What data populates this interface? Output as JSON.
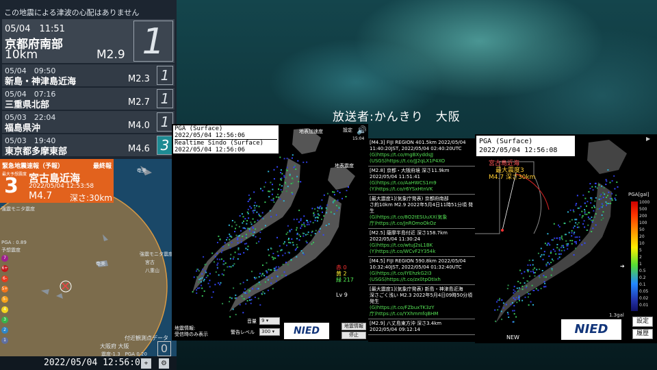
{
  "broadcaster": "放送者:かんきり　大阪",
  "left": {
    "tsunami_notice": "この地震による津波の心配はありません",
    "latest": {
      "time": "05/04　11:51",
      "region": "京都府南部",
      "depth": "10km",
      "magnitude": "M2.9",
      "intensity": "1"
    },
    "history": [
      {
        "time": "05/04　09:50",
        "region": "新島・神津島近海",
        "magnitude": "M2.3",
        "intensity": "1"
      },
      {
        "time": "05/04　07:16",
        "region": "三重県北部",
        "magnitude": "M2.7",
        "intensity": "1"
      },
      {
        "time": "05/03　22:04",
        "region": "福島県沖",
        "magnitude": "M4.0",
        "intensity": "1"
      },
      {
        "time": "05/03　19:40",
        "region": "東京都多摩東部",
        "magnitude": "M4.6",
        "intensity": "3"
      }
    ],
    "eew": {
      "header": "緊急地震速報（予報）",
      "final": "最終報",
      "max_label": "最大予想震度",
      "intensity": "3",
      "region": "宮古島近海",
      "time": "2022/05/04 12:53:58",
      "magnitude": "M4.7",
      "depth": "深さ:30km"
    },
    "map_labels": {
      "amami": "奄美",
      "station_label": "強震モニタ震度",
      "pga_label": "PGA : 0.89",
      "forecast_label": "予想震度",
      "miyako": "宮古",
      "yaeyama": "八重山",
      "nearby": "付近観測点データ",
      "osaka": "大阪府 大阪",
      "intensity_info": "震度-1.3　PGA 0.20",
      "station_value": "0",
      "top_label": "強震モニタ震度"
    },
    "scale_labels": [
      "7",
      "6+",
      "6-",
      "5+",
      "5-",
      "4",
      "3",
      "2",
      "1"
    ],
    "scale_colors": [
      "#a0208f",
      "#c4151b",
      "#e8391d",
      "#f2741b",
      "#f6a21b",
      "#f5d51e",
      "#37b34a",
      "#2e86c7",
      "#5e6fa0"
    ],
    "datetime": "2022/05/04 12:56:07"
  },
  "middle": {
    "pga_line1": "PGA (Surface)",
    "pga_time1": "2022/05/04 12:56:06",
    "sindo_line1": "Realtime Sindo (Surface)",
    "sindo_time": "2022/05/04 12:56:06",
    "label_accel": "地表加速度",
    "label_sindo": "地表震度",
    "setting": "設定",
    "clock": "15:04",
    "counts": {
      "red": "赤 0",
      "yellow": "黄 2",
      "green": "緑 217"
    },
    "level": "Lv 9",
    "earthquake_info_title": "地震情報:",
    "earthquake_info_status": "受信時のみ表示",
    "volume_label": "音量",
    "volume_value": "9",
    "warn_label": "警告レベル",
    "warn_value": "300",
    "quake_button": "地震情報",
    "stop_button": "停止",
    "brand": "NIED"
  },
  "tweets": [
    {
      "title": "[M4.3] FIJI REGION 401.5km 2022/05/04",
      "body": "11:40:20JST, 2022/05/04 02:40:20UTC",
      "links": [
        "(G)https://t.co/mgBXyddsJJ",
        "(USGS)https://t.co/JJ2qLX1P4XO"
      ]
    },
    {
      "title": "[M2.8] 京都・大阪府境 深さ11.9km",
      "body": "2022/05/04 11:51:41",
      "links": [
        "(G)https://t.co/AaHWCS1m9",
        "(Y)https://t.co/r6YSxHtnVK"
      ]
    },
    {
      "title": "[最大震度1](気象庁発表) 京都府南部",
      "body": "さ約10km M2.9 2022年5月4日11時51分頃 発生",
      "links": [
        "(G)https://t.co/8O2tESUuXX(気象",
        "庁)https://t.co/JnROmoOkOz"
      ]
    },
    {
      "title": "[M2.5] 薩摩半島付近 深さ158.7km",
      "body": "2022/05/04 11:30:24",
      "links": [
        "(G)https://t.co/wtuJ2sL1BK",
        "(Y)https://t.co/WCvF2Y354k"
      ]
    },
    {
      "title": "[M4.5] FIJI REGION 590.8km 2022/05/04",
      "body": "10:32:40JST, 2022/05/04 01:32:40UTC",
      "links": [
        "(G)https://t.co/IYEhzkG2I3",
        "(USGS)https://t.co/zx0tpOtIxh"
      ]
    },
    {
      "title": "[最大震度1](気象庁発表) 新島・神津島近海",
      "body": "深さごく浅い M2.3 2022年5月4日09時50分頃発生",
      "links": [
        "(G)https://t.co/FZbuxTK3zY",
        "庁)https://t.co/YXhmmfqBHM"
      ]
    },
    {
      "title": "[M2.9] 八丈島東方沖 深さ3.4km",
      "body": "2022/05/04 09:12:14",
      "links": []
    }
  ],
  "right": {
    "pga_title": "PGA (Surface)",
    "pga_time": "2022/05/04 12:56:08",
    "epicenter": "宮古島近海",
    "max_intensity": "最大震度3",
    "quake": "M4.7 深さ30km",
    "legend_title": "PGA[gal]",
    "legend_values": [
      "1000",
      "500",
      "200",
      "100",
      "50",
      "20",
      "10",
      "5",
      "2",
      "1",
      "0.5",
      "0.2",
      "0.1",
      "0.05",
      "0.02",
      "0.01"
    ],
    "current_value": "1.3gal",
    "new_label": "NEW",
    "settings_button": "設定",
    "history_button": "履歴",
    "brand": "NIED"
  }
}
